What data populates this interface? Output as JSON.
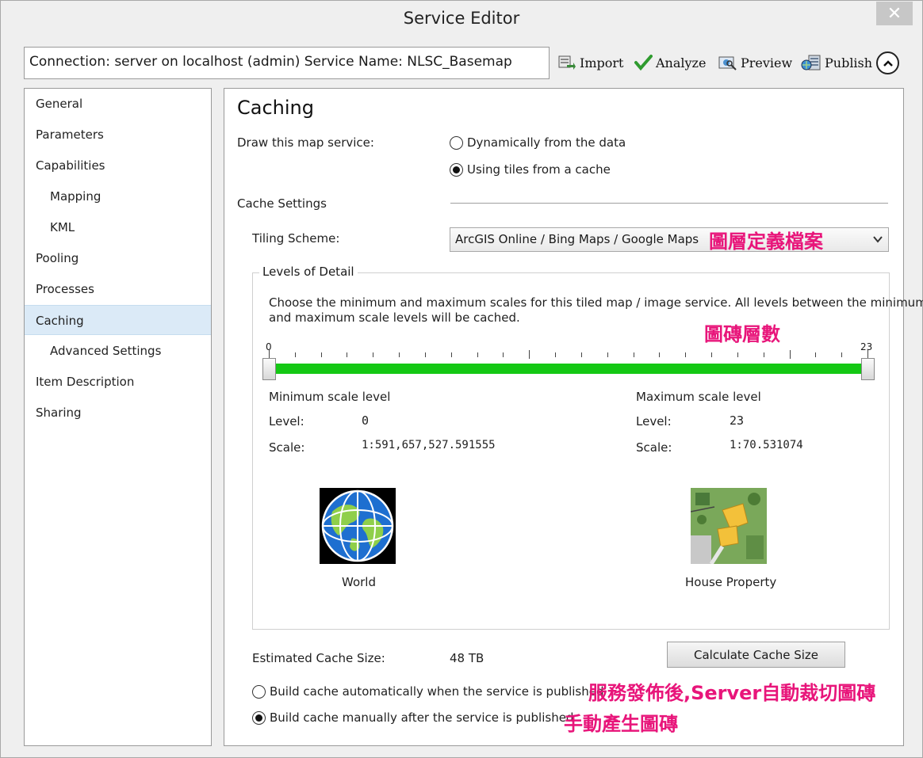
{
  "window": {
    "title": "Service Editor",
    "close_glyph": "✕"
  },
  "connection_text": "Connection: server on localhost (admin)   Service Name: NLSC_Basemap",
  "toolbar": {
    "import_label": "Import",
    "analyze_label": "Analyze",
    "preview_label": "Preview",
    "publish_label": "Publish"
  },
  "nav": {
    "items": [
      {
        "label": "General"
      },
      {
        "label": "Parameters"
      },
      {
        "label": "Capabilities"
      },
      {
        "label": "Mapping"
      },
      {
        "label": "KML"
      },
      {
        "label": "Pooling"
      },
      {
        "label": "Processes"
      },
      {
        "label": "Caching"
      },
      {
        "label": "Advanced Settings"
      },
      {
        "label": "Item Description"
      },
      {
        "label": "Sharing"
      }
    ],
    "active": "Caching"
  },
  "caching": {
    "title": "Caching",
    "draw_label": "Draw this map service:",
    "draw_options": [
      {
        "label": "Dynamically from the data",
        "selected": false
      },
      {
        "label": "Using tiles from a cache",
        "selected": true
      }
    ],
    "cache_settings_label": "Cache Settings",
    "tiling_scheme_label": "Tiling Scheme:",
    "tiling_scheme_value": "ArcGIS Online / Bing Maps / Google Maps",
    "lod": {
      "legend": "Levels of Detail",
      "description_line1": "Choose the minimum and maximum scales for this tiled map / image service. All levels between the minimum",
      "description_line2": "and maximum scale levels will be cached.",
      "tick_min": "0",
      "tick_max": "23",
      "range_min": 0,
      "range_max": 23,
      "selected_min": 0,
      "selected_max": 23,
      "min": {
        "heading": "Minimum scale level",
        "level_label": "Level:",
        "level_value": "0",
        "scale_label": "Scale:",
        "scale_value": "1:591,657,527.591555",
        "image_caption": "World"
      },
      "max": {
        "heading": "Maximum scale level",
        "level_label": "Level:",
        "level_value": "23",
        "scale_label": "Scale:",
        "scale_value": "1:70.531074",
        "image_caption": "House Property"
      }
    },
    "estimated_label": "Estimated Cache Size:",
    "estimated_value": "48 TB",
    "calculate_button": "Calculate Cache Size",
    "build_options": [
      {
        "label": "Build cache automatically when the service is published",
        "selected": false
      },
      {
        "label": "Build cache manually after the service is published",
        "selected": true
      }
    ]
  },
  "annotations": {
    "tiling": "圖層定義檔案",
    "levels": "圖磚層數",
    "auto": "服務發佈後,Server自動裁切圖磚",
    "manual": "手動產生圖磚"
  },
  "colors": {
    "slider": "#14c814",
    "annotation": "#e8157a",
    "active_nav": "#dbeaf7"
  }
}
